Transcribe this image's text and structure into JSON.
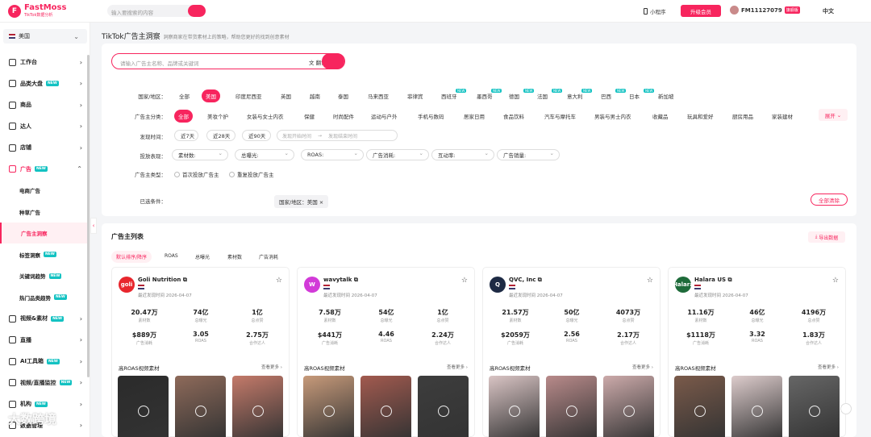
{
  "topbar": {
    "brand": "FastMoss",
    "brand_sub": "TikTok数据分析",
    "search_placeholder": "输入要搜索的内容",
    "mini_program": "小程序",
    "upgrade": "升级会员",
    "username": "FM11127079",
    "user_badge": "旗舰版",
    "language": "中文"
  },
  "sidebar": {
    "country": "美国",
    "items": [
      {
        "label": "工作台",
        "icon": "home-icon",
        "new": false
      },
      {
        "label": "品类大盘",
        "icon": "chart-icon",
        "new": true
      },
      {
        "label": "商品",
        "icon": "shopping-bag-icon",
        "new": false
      },
      {
        "label": "达人",
        "icon": "people-icon",
        "new": false
      },
      {
        "label": "店铺",
        "icon": "store-icon",
        "new": false
      },
      {
        "label": "广告",
        "icon": "megaphone-icon",
        "new": true
      }
    ],
    "ad_sub": [
      {
        "label": "电商广告",
        "new": false
      },
      {
        "label": "种草广告",
        "new": false
      },
      {
        "label": "广告主洞察",
        "new": false
      },
      {
        "label": "标签洞察",
        "new": true
      },
      {
        "label": "关键词趋势",
        "new": true
      },
      {
        "label": "热门品类趋势",
        "new": true
      }
    ],
    "items_bottom": [
      {
        "label": "视频&素材",
        "icon": "video-icon",
        "new": true
      },
      {
        "label": "直播",
        "icon": "live-icon",
        "new": false
      },
      {
        "label": "AI工具箱",
        "icon": "ai-icon",
        "new": true
      },
      {
        "label": "视频/直播监控",
        "icon": "monitor-icon",
        "new": true
      },
      {
        "label": "机构",
        "icon": "org-icon",
        "new": true
      },
      {
        "label": "数据管理",
        "icon": "data-icon",
        "new": false
      }
    ]
  },
  "page": {
    "title": "TikTok广告主洞察",
    "subtitle": "洞察商家在带货素材上的策略，帮助您更好的找到创意素材"
  },
  "filters": {
    "search_placeholder": "请输入广告主名称、品牌或关键词",
    "translate": "翻译",
    "region_label": "国家/地区：",
    "regions": [
      "全部",
      "美国",
      "印度尼西亚",
      "英国",
      "越南",
      "泰国",
      "马来西亚",
      "菲律宾",
      "西班牙",
      "墨西哥",
      "德国",
      "法国",
      "意大利",
      "巴西",
      "日本",
      "新加坡"
    ],
    "category_label": "广告主分类：",
    "categories": [
      "全部",
      "美妆个护",
      "女装与女士内衣",
      "保健",
      "时尚配件",
      "运动与户外",
      "手机与数码",
      "居家日用",
      "食品饮料",
      "汽车与摩托车",
      "男装与男士内衣",
      "收藏品",
      "玩具和爱好",
      "厨房用品",
      "家装建材"
    ],
    "expand": "展开",
    "time_label": "发现时间：",
    "times": [
      "近7天",
      "近28天",
      "近90天"
    ],
    "date_start": "发现开始时间",
    "date_end": "发现结束时间",
    "perf_label": "投放表现：",
    "perf": [
      "素材数:",
      "总曝光:",
      "ROAS:",
      "广告消耗:",
      "互动率:",
      "广告销量:"
    ],
    "type_label": "广告主类型：",
    "types": [
      "首次投放广告主",
      "重复投放广告主"
    ],
    "selected_label": "已选条件：",
    "selected_value": "国家/地区：美国",
    "clear": "全部清除"
  },
  "list": {
    "title": "广告主列表",
    "export": "导出数据",
    "sort_tabs": [
      "默认排序/降序",
      "ROAS",
      "总曝光",
      "素材数",
      "广告消耗"
    ],
    "video_title": "高ROAS视频素材",
    "more": "查看更多",
    "advertisers": [
      {
        "name": "Goli Nutrition",
        "logo_text": "goli",
        "color": "#e8262d",
        "time": "最近发现时间 2026-04-07",
        "s1": "20.47万",
        "s1l": "素材数",
        "s2": "74亿",
        "s2l": "总曝光",
        "s3": "1亿",
        "s3l": "总点赞",
        "s4": "$889万",
        "s4l": "广告消耗",
        "s5": "3.05",
        "s5l": "ROAS",
        "s6": "2.75万",
        "s6l": "合作达人"
      },
      {
        "name": "wavytalk",
        "logo_text": "W",
        "color": "#d23ad8",
        "time": "最近发现时间 2026-04-07",
        "s1": "7.58万",
        "s1l": "素材数",
        "s2": "54亿",
        "s2l": "总曝光",
        "s3": "1亿",
        "s3l": "总点赞",
        "s4": "$441万",
        "s4l": "广告消耗",
        "s5": "4.46",
        "s5l": "ROAS",
        "s6": "2.24万",
        "s6l": "合作达人"
      },
      {
        "name": "QVC, Inc",
        "logo_text": "Q",
        "color": "#1d2a44",
        "time": "最近发现时间 2026-04-07",
        "s1": "21.57万",
        "s1l": "素材数",
        "s2": "50亿",
        "s2l": "总曝光",
        "s3": "4073万",
        "s3l": "总点赞",
        "s4": "$2059万",
        "s4l": "广告消耗",
        "s5": "2.56",
        "s5l": "ROAS",
        "s6": "2.17万",
        "s6l": "合作达人"
      },
      {
        "name": "Halara US",
        "logo_text": "Halara",
        "color": "#1e6b3a",
        "time": "最近发现时间 2026-04-07",
        "s1": "11.16万",
        "s1l": "素材数",
        "s2": "46亿",
        "s2l": "总曝光",
        "s3": "4196万",
        "s3l": "总点赞",
        "s4": "$1118万",
        "s4l": "广告消耗",
        "s5": "3.32",
        "s5l": "ROAS",
        "s6": "1.83万",
        "s6l": "合作达人"
      }
    ]
  },
  "watermark": "大数跨境"
}
